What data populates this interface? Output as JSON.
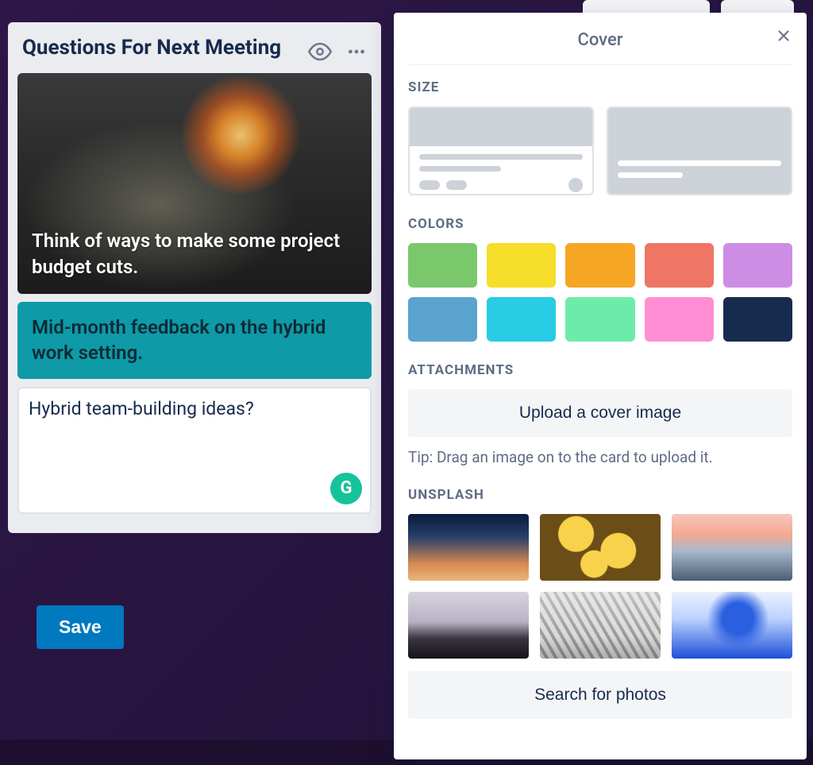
{
  "list": {
    "title": "Questions For Next Meeting",
    "cards": [
      {
        "text": "Think of ways to make some project budget cuts.",
        "kind": "cover"
      },
      {
        "text": "Mid-month feedback on the hybrid work setting.",
        "kind": "teal"
      }
    ],
    "composer": {
      "value": "Hybrid team-building ideas?"
    },
    "save_label": "Save"
  },
  "popover": {
    "title": "Cover",
    "sections": {
      "size_label": "SIZE",
      "colors_label": "COLORS",
      "attachments_label": "ATTACHMENTS",
      "unsplash_label": "UNSPLASH"
    },
    "upload_label": "Upload a cover image",
    "tip": "Tip: Drag an image on to the card to upload it.",
    "search_label": "Search for photos",
    "colors": [
      "#7bc86c",
      "#f5dd29",
      "#f5a623",
      "#ef7564",
      "#cd8de5",
      "#5ba4cf",
      "#29cce5",
      "#6deca9",
      "#ff8ed4",
      "#172b4d"
    ],
    "unsplash_thumbs": [
      "u1",
      "u2",
      "u3",
      "u4",
      "u5",
      "u6"
    ]
  }
}
